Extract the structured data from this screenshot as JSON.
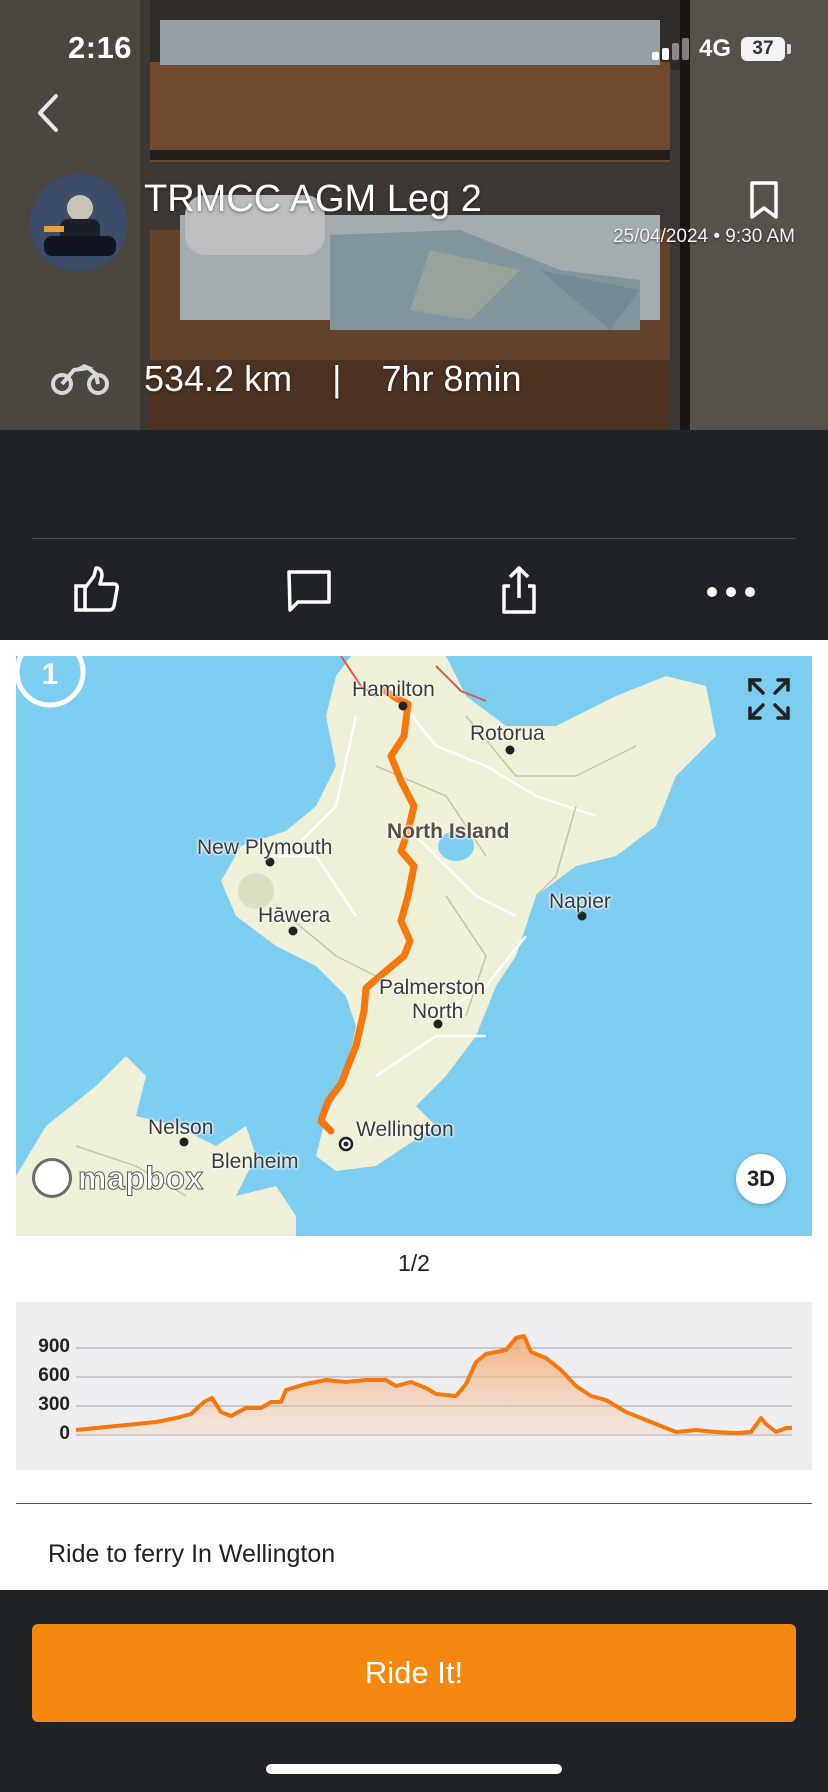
{
  "status_bar": {
    "time": "2:16",
    "network": "4G",
    "battery": "37"
  },
  "ride": {
    "title": "TRMCC AGM Leg 2",
    "date": "25/04/2024 • 9:30 AM",
    "distance": "534.2 km",
    "separator": "|",
    "duration": "7hr 8min"
  },
  "actions": {
    "like_icon": "thumbs-up-icon",
    "comment_icon": "comment-icon",
    "share_icon": "share-icon",
    "more_icon": "more-horizontal-icon"
  },
  "map": {
    "step_number": "1",
    "labels": {
      "hamilton": "Hamilton",
      "rotorua": "Rotorua",
      "north_island": "North Island",
      "new_plymouth": "New Plymouth",
      "hawera": "Hāwera",
      "napier": "Napier",
      "palmerston_1": "Palmerston",
      "palmerston_2": "North",
      "wellington": "Wellington",
      "nelson": "Nelson",
      "blenheim": "Blenheim"
    },
    "mapbox_text": "mapbox",
    "btn_3d": "3D",
    "route_color": "#f5780f",
    "water_color": "#7dcdf0",
    "land_color": "#eef0d8"
  },
  "pager": "1/2",
  "elevation": {
    "ticks": [
      "900",
      "600",
      "300",
      "0"
    ],
    "fill_color": "#f5a56a",
    "line_color": "#f5780f"
  },
  "description": "Ride to ferry In Wellington",
  "cta": {
    "label": "Ride It!",
    "color": "#f5880f"
  }
}
